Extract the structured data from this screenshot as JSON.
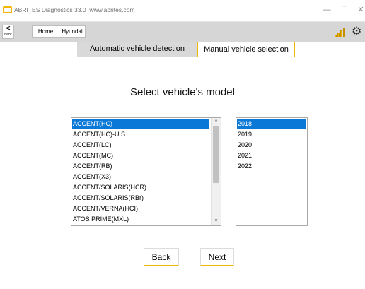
{
  "window": {
    "title": "ABRITES Diagnostics 33.0",
    "url": "www.abrites.com",
    "minimize": "—",
    "maximize": "☐",
    "close": "✕"
  },
  "toolbar": {
    "back_arrow": "<",
    "back_label": "back",
    "home_label": "Home",
    "brand_label": "Hyundai",
    "settings_glyph": "⚙"
  },
  "tabs": [
    {
      "label": "Automatic vehicle detection",
      "active": false
    },
    {
      "label": "Manual vehicle selection",
      "active": true
    }
  ],
  "main": {
    "heading": "Select vehicle's model",
    "models": [
      "ACCENT(HC)",
      "ACCENT(HC)-U.S.",
      "ACCENT(LC)",
      "ACCENT(MC)",
      "ACCENT(RB)",
      "ACCENT(X3)",
      "ACCENT/SOLARIS(HCR)",
      "ACCENT/SOLARIS(RBr)",
      "ACCENT/VERNA(HCI)",
      "ATOS PRIME(MXL)"
    ],
    "selected_model": "ACCENT(HC)",
    "years": [
      "2018",
      "2019",
      "2020",
      "2021",
      "2022"
    ],
    "selected_year": "2018",
    "scroll_up": "^",
    "scroll_down": "v"
  },
  "actions": {
    "back_label": "Back",
    "next_label": "Next"
  },
  "colors": {
    "accent": "#f2b705",
    "selection": "#0a78d7",
    "toolbar_bg": "#d6d6d6"
  }
}
